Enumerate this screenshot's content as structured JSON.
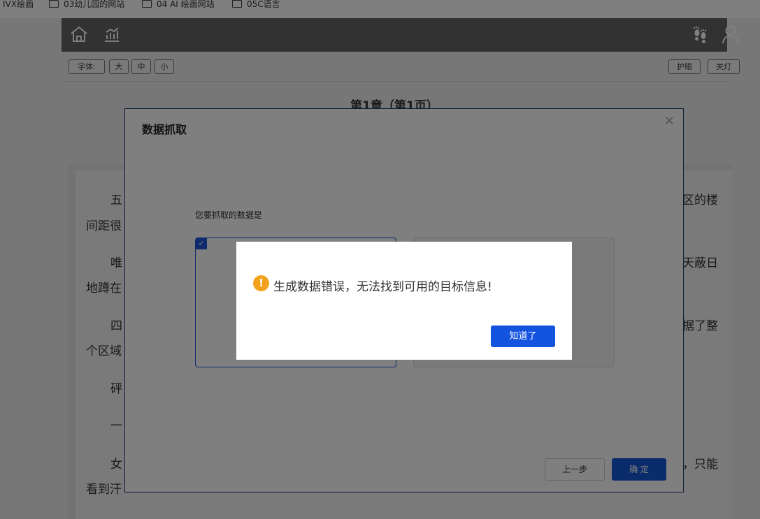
{
  "bookmarks": [
    {
      "label": "IVX绘画",
      "folder": false
    },
    {
      "label": "03幼儿园的网站",
      "folder": true
    },
    {
      "label": "04 AI 绘画网站",
      "folder": true
    },
    {
      "label": "05C语言",
      "folder": true
    }
  ],
  "topbar": {
    "left_icons": [
      "home-icon",
      "chart-icon"
    ],
    "right_icons": [
      "footprints-icon",
      "user-icon"
    ]
  },
  "font_controls": {
    "label": "字体:",
    "large": "大",
    "medium": "中",
    "small": "小",
    "eye_care": "护眼",
    "lights_off": "关灯"
  },
  "chapter_title": "第1章（第1页）",
  "reader_text": {
    "p1_start": "五",
    "p1_end": "区的楼",
    "p1_line2": "间距很",
    "p2_start": "唯",
    "p2_end": "天蔽日",
    "p2_line2": "地蹲在",
    "p3_start": "四",
    "p3_end": "据了整",
    "p3_line2": "个区域",
    "p4_start": "砰",
    "p5_start": "一",
    "p6_start": "女",
    "p6_end": "，只能",
    "p6_line2": "看到汗"
  },
  "dialog": {
    "title": "数据抓取",
    "close": "×",
    "prompt": "您要抓取的数据是",
    "check_mark": "✓",
    "prev_button": "上一步",
    "confirm_button": "确 定"
  },
  "alert": {
    "icon": "!",
    "message": "生成数据错误，无法找到可用的目标信息!",
    "button": "知道了"
  },
  "colors": {
    "topbar": "#646464",
    "primary": "#1558d6",
    "warning": "#f3a21c"
  }
}
